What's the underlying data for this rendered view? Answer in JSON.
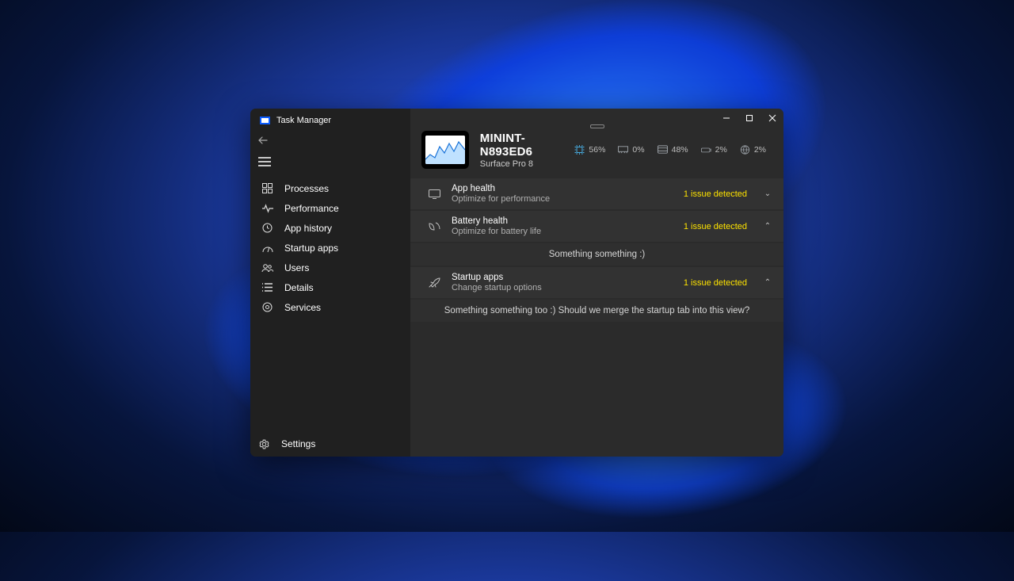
{
  "app_title": "Task Manager",
  "sidebar": {
    "items": [
      {
        "icon": "grid",
        "label": "Processes"
      },
      {
        "icon": "perf",
        "label": "Performance"
      },
      {
        "icon": "hist",
        "label": "App history"
      },
      {
        "icon": "startup",
        "label": "Startup apps"
      },
      {
        "icon": "users",
        "label": "Users"
      },
      {
        "icon": "details",
        "label": "Details"
      },
      {
        "icon": "services",
        "label": "Services"
      }
    ],
    "settings_label": "Settings"
  },
  "header": {
    "hostname": "MININT-N893ED6",
    "model": "Surface Pro 8",
    "stats": {
      "cpu": "56%",
      "memory": "0%",
      "disk": "48%",
      "network": "2%",
      "gpu": "2%"
    }
  },
  "health": {
    "app": {
      "title": "App health",
      "subtitle": "Optimize for performance",
      "badge": "1 issue detected",
      "expanded": false
    },
    "battery": {
      "title": "Battery health",
      "subtitle": "Optimize for battery life",
      "badge": "1 issue detected",
      "expanded": true,
      "body": "Something something :)"
    },
    "startup": {
      "title": "Startup apps",
      "subtitle": "Change startup options",
      "badge": "1 issue detected",
      "expanded": true,
      "body": "Something something too :) Should we merge the startup tab into this view?"
    }
  }
}
